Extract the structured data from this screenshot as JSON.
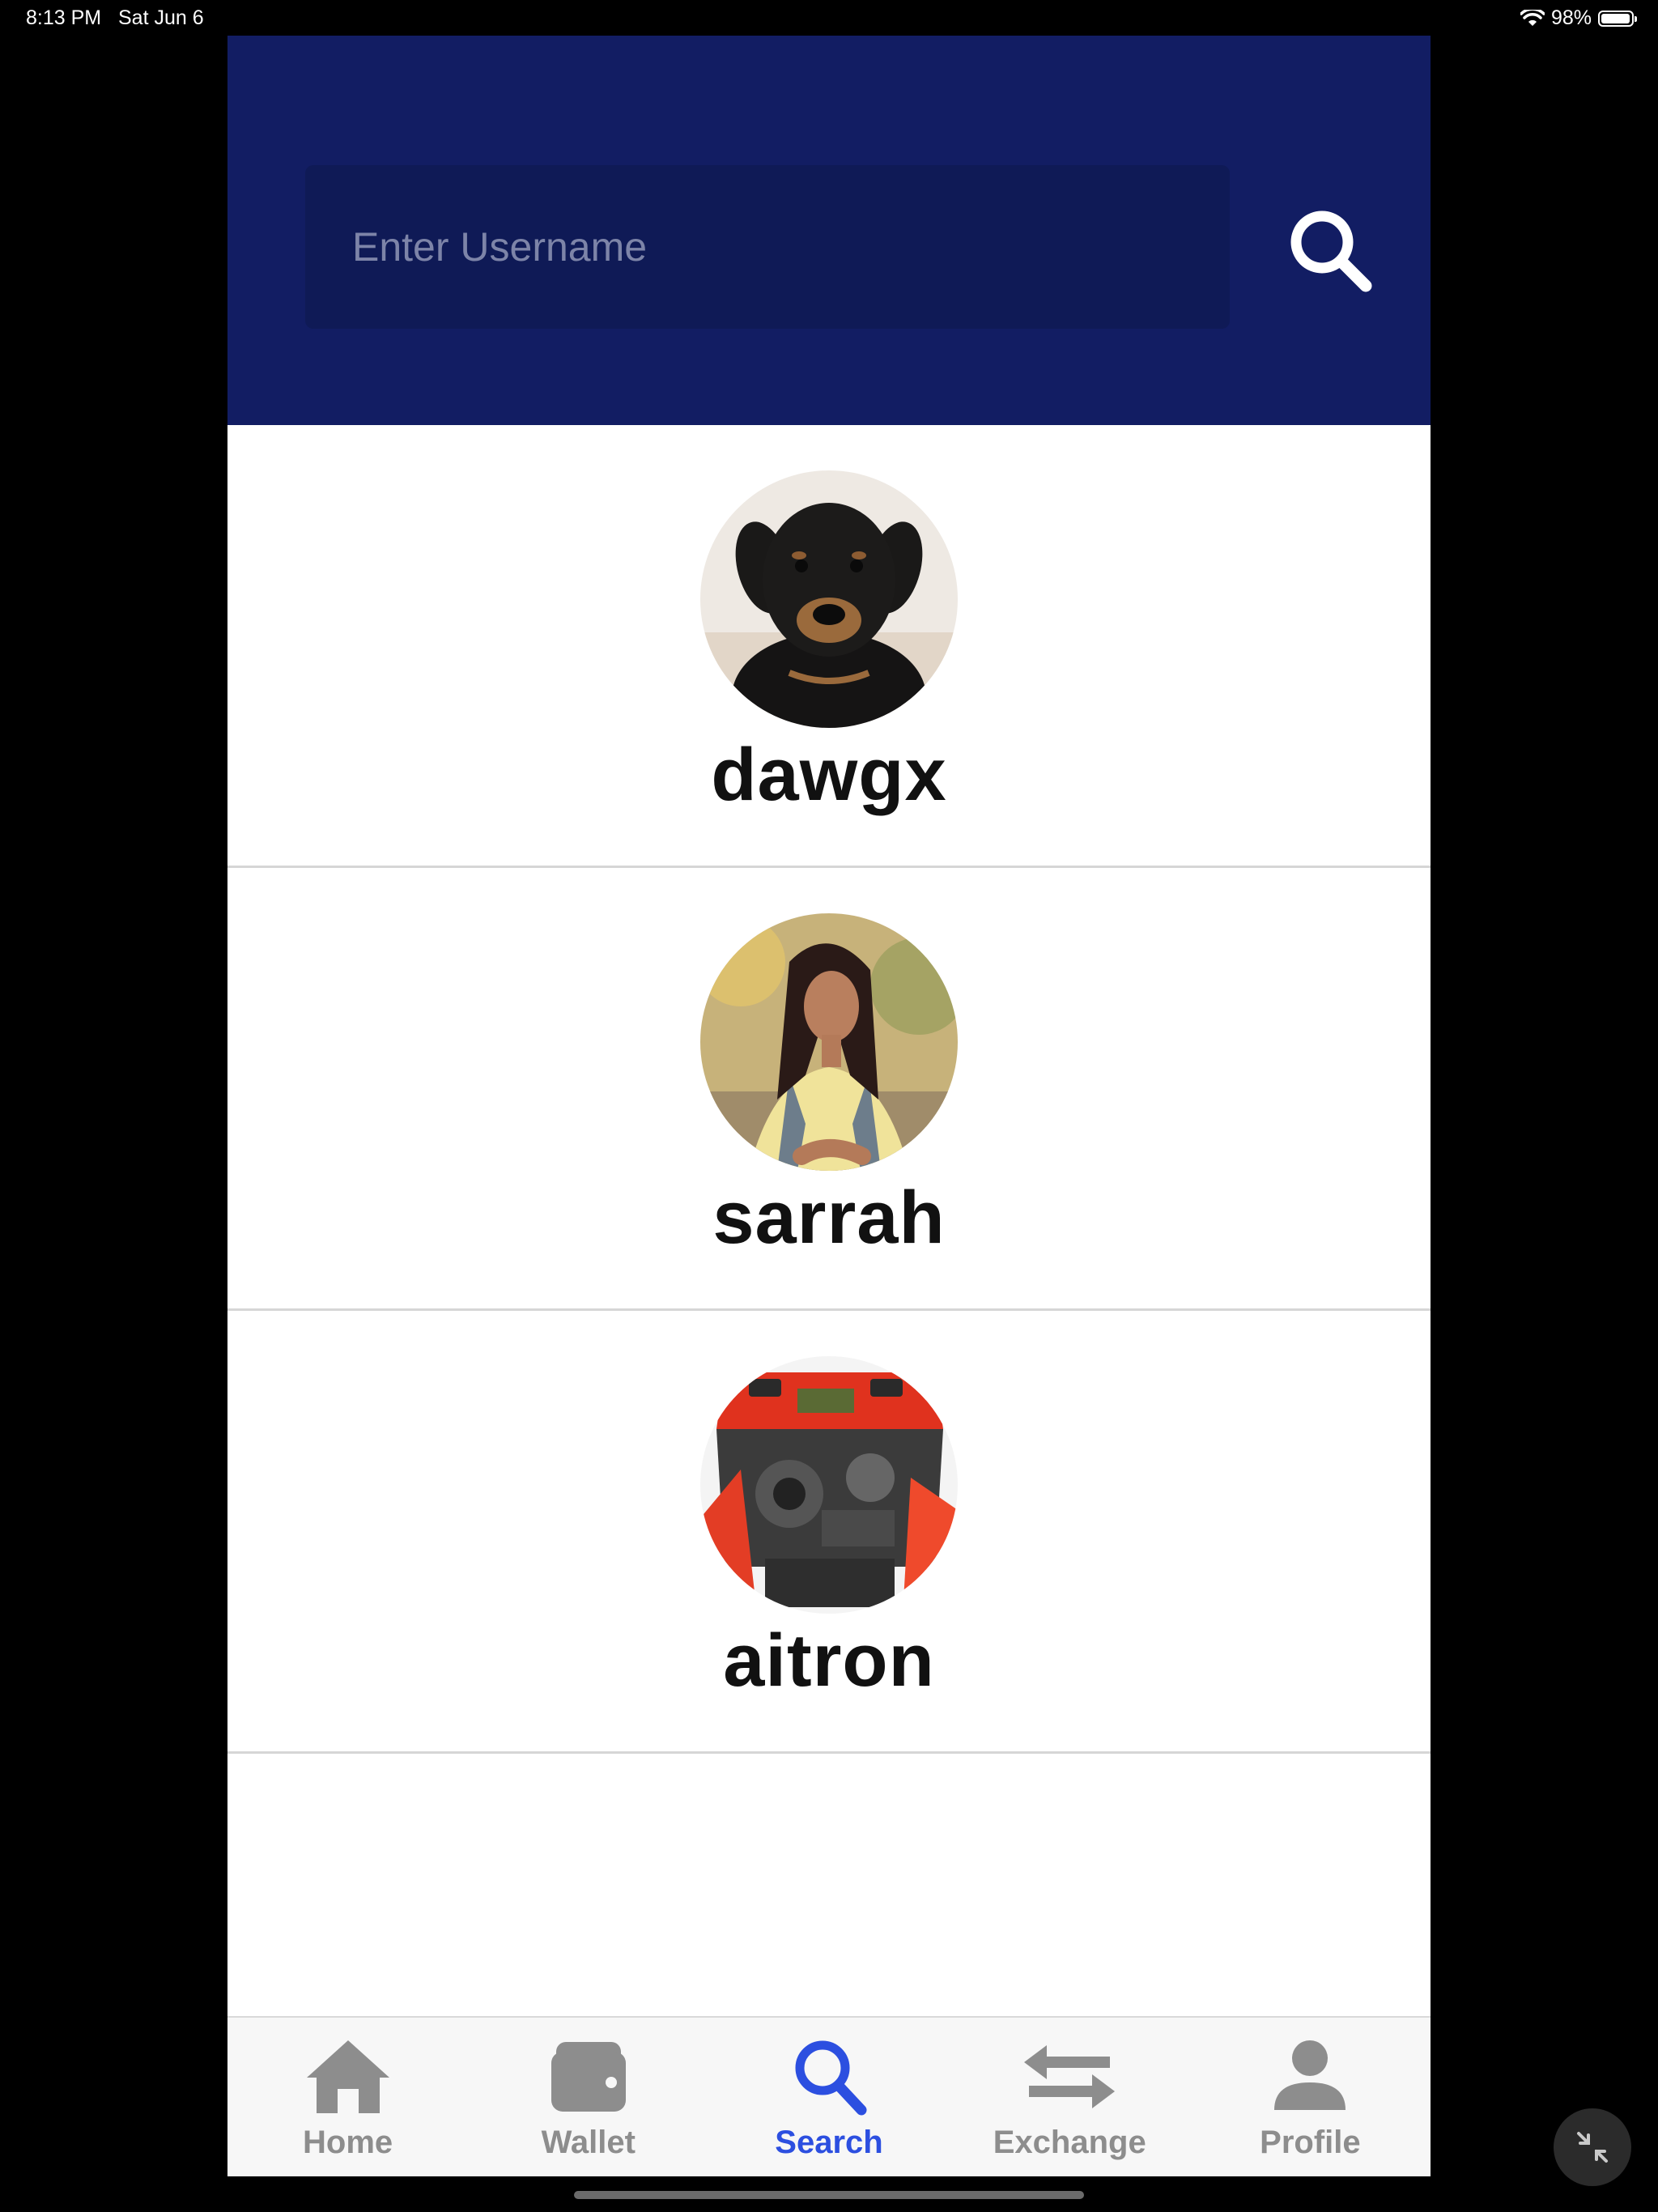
{
  "status_bar": {
    "time": "8:13 PM",
    "date": "Sat Jun 6",
    "battery": "98%",
    "battery_level": 0.98
  },
  "search": {
    "placeholder": "Enter Username",
    "value": ""
  },
  "colors": {
    "header_bg": "#121d63",
    "active_tab": "#2c4fe0",
    "inactive_tab": "#8d8d8d"
  },
  "results": [
    {
      "username": "dawgx",
      "avatar": "puppy-photo"
    },
    {
      "username": "sarrah",
      "avatar": "woman-portrait-photo"
    },
    {
      "username": "aitron",
      "avatar": "car-engine-photo"
    }
  ],
  "tabs": [
    {
      "label": "Home",
      "icon": "home-icon",
      "active": false
    },
    {
      "label": "Wallet",
      "icon": "wallet-icon",
      "active": false
    },
    {
      "label": "Search",
      "icon": "search-icon",
      "active": true
    },
    {
      "label": "Exchange",
      "icon": "exchange-icon",
      "active": false
    },
    {
      "label": "Profile",
      "icon": "profile-icon",
      "active": false
    }
  ]
}
